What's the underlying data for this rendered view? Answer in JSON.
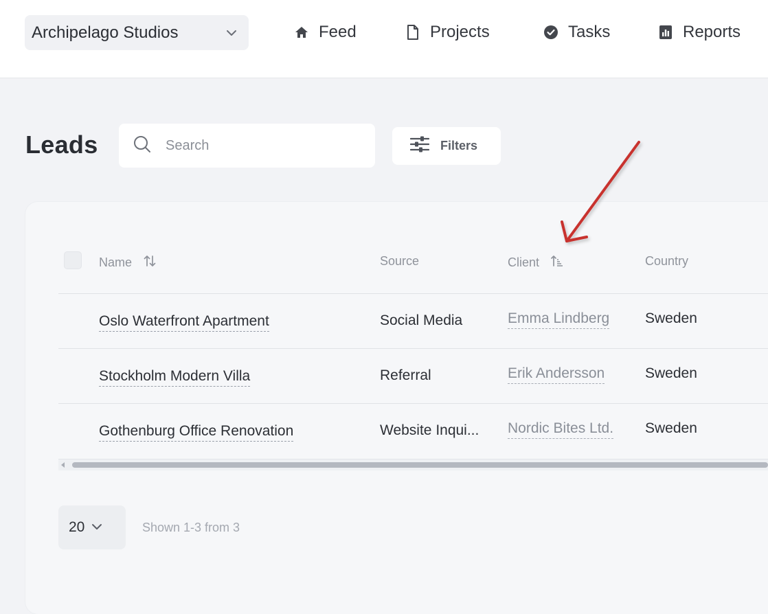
{
  "header": {
    "workspace_name": "Archipelago Studios",
    "nav": [
      {
        "label": "Feed",
        "icon": "home-icon"
      },
      {
        "label": "Projects",
        "icon": "document-icon"
      },
      {
        "label": "Tasks",
        "icon": "check-circle-icon"
      },
      {
        "label": "Reports",
        "icon": "report-icon"
      }
    ]
  },
  "page": {
    "title": "Leads",
    "search_placeholder": "Search",
    "filters_label": "Filters"
  },
  "table": {
    "columns": [
      {
        "label": "Name",
        "sort_icon": "sort-arrows-icon"
      },
      {
        "label": "Source"
      },
      {
        "label": "Client",
        "sort_icon": "sort-ascending-icon"
      },
      {
        "label": "Country"
      }
    ],
    "rows": [
      {
        "name": "Oslo Waterfront Apartment",
        "source": "Social Media",
        "client": "Emma Lindberg",
        "country": "Sweden"
      },
      {
        "name": "Stockholm Modern Villa",
        "source": "Referral",
        "client": "Erik Andersson",
        "country": "Sweden"
      },
      {
        "name": "Gothenburg Office Renovation",
        "source": "Website Inqui...",
        "client": "Nordic Bites Ltd.",
        "country": "Sweden"
      }
    ]
  },
  "pagination": {
    "page_size": "20",
    "shown_text": "Shown 1-3 from 3"
  },
  "colors": {
    "annotation_arrow": "#c8312d",
    "page_background": "#f2f3f6",
    "muted_text": "#8f939b"
  }
}
